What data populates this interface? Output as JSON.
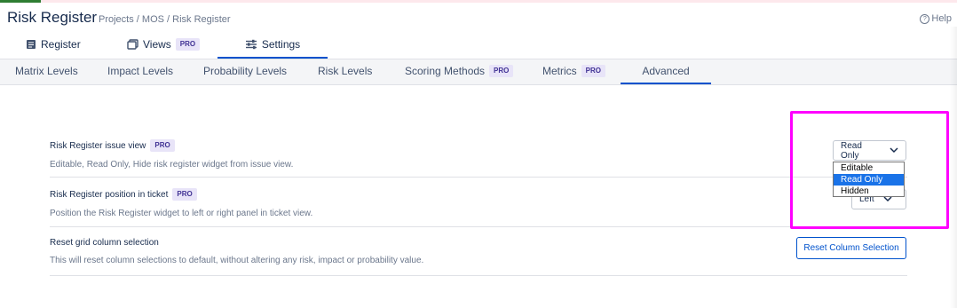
{
  "header": {
    "title": "Risk Register",
    "breadcrumb": "Projects / MOS / Risk Register",
    "help_label": "Help"
  },
  "main_tabs": [
    {
      "label": "Register",
      "icon": "register-icon"
    },
    {
      "label": "Views",
      "icon": "views-icon",
      "badge": "PRO"
    },
    {
      "label": "Settings",
      "icon": "settings-sliders-icon",
      "active": true
    }
  ],
  "sub_tabs": [
    {
      "label": "Matrix Levels"
    },
    {
      "label": "Impact Levels"
    },
    {
      "label": "Probability Levels"
    },
    {
      "label": "Risk Levels"
    },
    {
      "label": "Scoring Methods",
      "badge": "PRO"
    },
    {
      "label": "Metrics",
      "badge": "PRO"
    },
    {
      "label": "Advanced",
      "active": true
    }
  ],
  "settings": [
    {
      "title": "Risk Register issue view",
      "badge": "PRO",
      "description": "Editable, Read Only, Hide risk register widget from issue view.",
      "select_value": "Read Only",
      "options": [
        "Editable",
        "Read Only",
        "Hidden"
      ],
      "selected_option": "Read Only"
    },
    {
      "title": "Risk Register position in ticket",
      "badge": "PRO",
      "description": "Position the Risk Register widget to left or right panel in ticket view.",
      "select_value": "Left"
    },
    {
      "title": "Reset grid column selection",
      "description": "This will reset column selections to default, without altering any risk, impact or probability value.",
      "button_label": "Reset Column Selection"
    }
  ],
  "colors": {
    "accent": "#0052cc",
    "pro_badge_bg": "#e8e4f8",
    "annotation": "#ff00ff",
    "selected_option": "#1a73e8"
  }
}
